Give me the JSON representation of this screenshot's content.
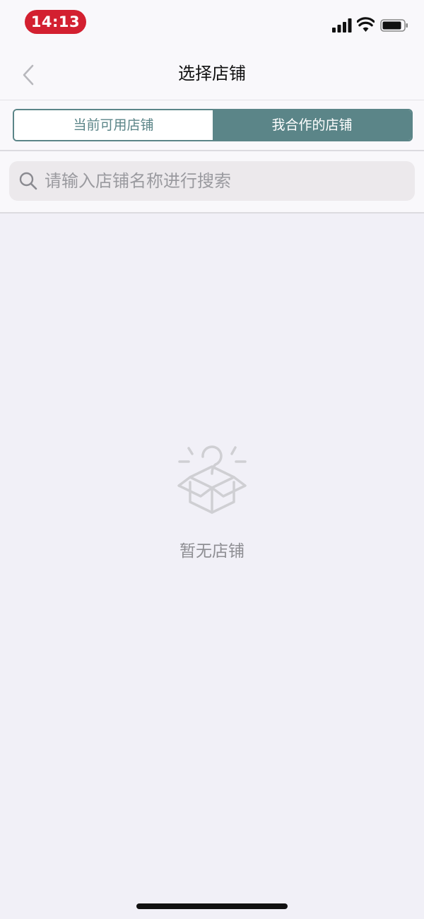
{
  "status_bar": {
    "time": "14:13"
  },
  "nav": {
    "title": "选择店铺"
  },
  "tabs": [
    {
      "label": "当前可用店铺",
      "selected": false
    },
    {
      "label": "我合作的店铺",
      "selected": true
    }
  ],
  "search": {
    "placeholder": "请输入店铺名称进行搜索"
  },
  "empty_state": {
    "message": "暂无店铺",
    "icon": "empty-box-question-icon"
  },
  "colors": {
    "accent": "#5b8588",
    "time_pill": "#d32030",
    "background": "#f1f0f7",
    "header_background": "#f9f8fb",
    "placeholder_text": "#9a9a9f",
    "empty_text": "#8e8e93"
  }
}
